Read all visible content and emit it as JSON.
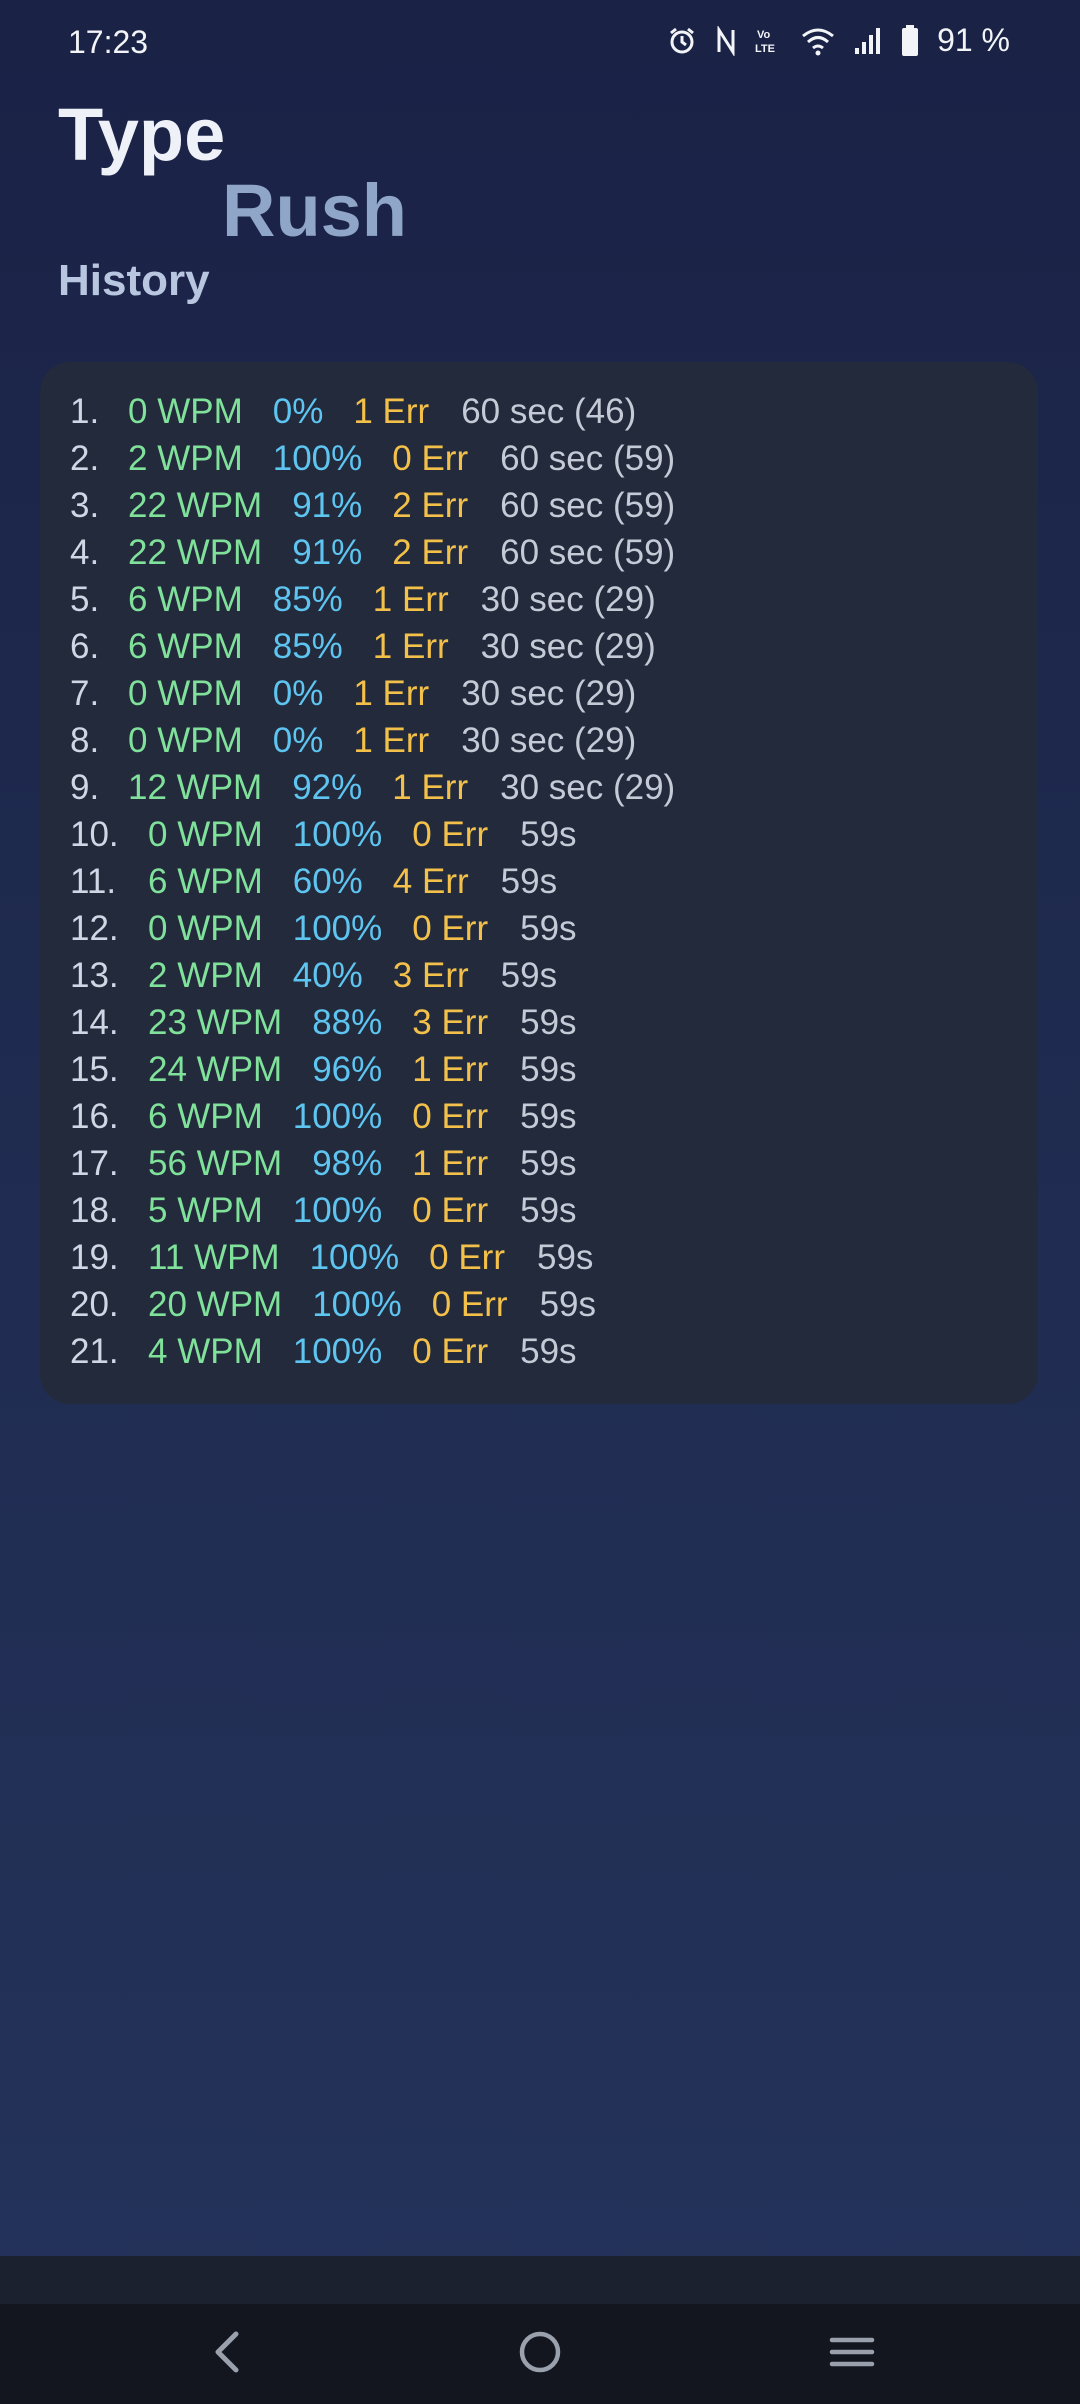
{
  "status": {
    "time": "17:23",
    "battery": "91 %",
    "icons": [
      "alarm-icon",
      "nfc-icon",
      "volte-icon",
      "wifi-icon",
      "signal-icon",
      "battery-icon"
    ]
  },
  "header": {
    "title_line1": "Type",
    "title_line2": "Rush",
    "subtitle": "History"
  },
  "history": [
    {
      "n": "1.",
      "wpm": "0 WPM",
      "acc": "0%",
      "err": "1 Err",
      "dur": "60 sec (46)"
    },
    {
      "n": "2.",
      "wpm": "2 WPM",
      "acc": "100%",
      "err": "0 Err",
      "dur": "60 sec (59)"
    },
    {
      "n": "3.",
      "wpm": "22 WPM",
      "acc": "91%",
      "err": "2 Err",
      "dur": "60 sec (59)"
    },
    {
      "n": "4.",
      "wpm": "22 WPM",
      "acc": "91%",
      "err": "2 Err",
      "dur": "60 sec (59)"
    },
    {
      "n": "5.",
      "wpm": "6 WPM",
      "acc": "85%",
      "err": "1 Err",
      "dur": "30 sec (29)"
    },
    {
      "n": "6.",
      "wpm": "6 WPM",
      "acc": "85%",
      "err": "1 Err",
      "dur": "30 sec (29)"
    },
    {
      "n": "7.",
      "wpm": "0 WPM",
      "acc": "0%",
      "err": "1 Err",
      "dur": "30 sec (29)"
    },
    {
      "n": "8.",
      "wpm": "0 WPM",
      "acc": "0%",
      "err": "1 Err",
      "dur": "30 sec (29)"
    },
    {
      "n": "9.",
      "wpm": "12 WPM",
      "acc": "92%",
      "err": "1 Err",
      "dur": "30 sec (29)"
    },
    {
      "n": "10.",
      "wpm": "0 WPM",
      "acc": "100%",
      "err": "0 Err",
      "dur": "59s"
    },
    {
      "n": "11.",
      "wpm": "6 WPM",
      "acc": "60%",
      "err": "4 Err",
      "dur": "59s"
    },
    {
      "n": "12.",
      "wpm": "0 WPM",
      "acc": "100%",
      "err": "0 Err",
      "dur": "59s"
    },
    {
      "n": "13.",
      "wpm": "2 WPM",
      "acc": "40%",
      "err": "3 Err",
      "dur": "59s"
    },
    {
      "n": "14.",
      "wpm": "23 WPM",
      "acc": "88%",
      "err": "3 Err",
      "dur": "59s"
    },
    {
      "n": "15.",
      "wpm": "24 WPM",
      "acc": "96%",
      "err": "1 Err",
      "dur": "59s"
    },
    {
      "n": "16.",
      "wpm": "6 WPM",
      "acc": "100%",
      "err": "0 Err",
      "dur": "59s"
    },
    {
      "n": "17.",
      "wpm": "56 WPM",
      "acc": "98%",
      "err": "1 Err",
      "dur": "59s"
    },
    {
      "n": "18.",
      "wpm": "5 WPM",
      "acc": "100%",
      "err": "0 Err",
      "dur": "59s"
    },
    {
      "n": "19.",
      "wpm": "11 WPM",
      "acc": "100%",
      "err": "0 Err",
      "dur": "59s"
    },
    {
      "n": "20.",
      "wpm": "20 WPM",
      "acc": "100%",
      "err": "0 Err",
      "dur": "59s"
    },
    {
      "n": "21.",
      "wpm": "4 WPM",
      "acc": "100%",
      "err": "0 Err",
      "dur": "59s"
    }
  ],
  "colors": {
    "wpm": "#80e19a",
    "accuracy": "#5ec4f0",
    "errors": "#f3c04a",
    "duration": "#c4cad6",
    "card": "#222a3c"
  },
  "nav": {
    "back": "back-icon",
    "home": "home-icon",
    "recents": "recents-icon"
  }
}
